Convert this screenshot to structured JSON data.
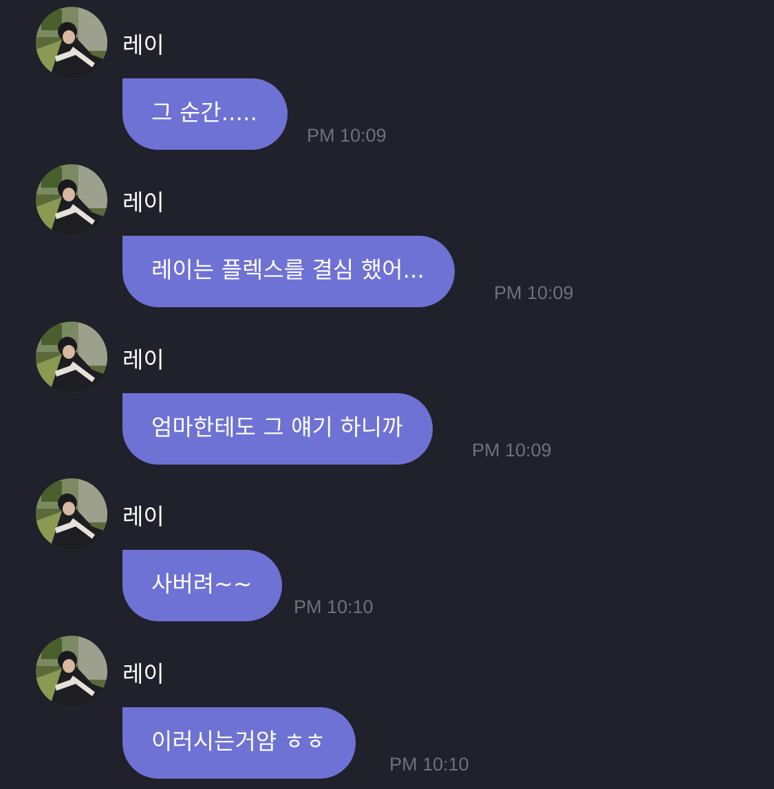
{
  "colors": {
    "background": "#20212a",
    "bubble": "#6e72d4",
    "bubble_text": "#ffffff",
    "sender_text": "#ffffff",
    "timestamp_text": "#6f717c"
  },
  "messages": [
    {
      "sender": "레이",
      "avatar_icon": "profile-photo",
      "text": "그 순간.....",
      "time": "PM 10:09"
    },
    {
      "sender": "레이",
      "avatar_icon": "profile-photo",
      "text": "레이는 플렉스를 결심 했어...",
      "time": "PM 10:09"
    },
    {
      "sender": "레이",
      "avatar_icon": "profile-photo",
      "text": "엄마한테도 그 얘기 하니까",
      "time": "PM 10:09"
    },
    {
      "sender": "레이",
      "avatar_icon": "profile-photo",
      "text": "사버려~~",
      "time": "PM 10:10"
    },
    {
      "sender": "레이",
      "avatar_icon": "profile-photo",
      "text": "이러시는거얌 ㅎㅎ",
      "time": "PM 10:10"
    }
  ]
}
